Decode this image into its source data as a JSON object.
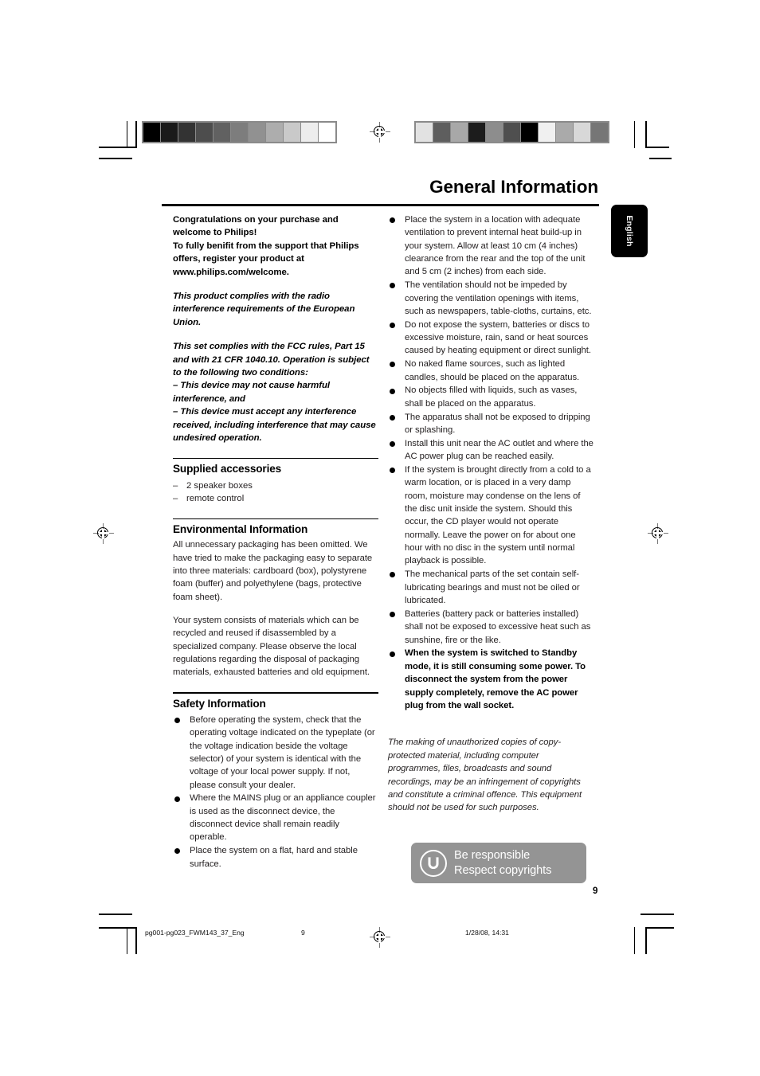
{
  "page": {
    "title": "General Information",
    "language_tab": "English",
    "page_number": "9"
  },
  "left_column": {
    "welcome_block": "Congratulations on your purchase and welcome to Philips!\nTo fully benifit from the support that Philips offers, register your product at www.philips.com/welcome.",
    "eu_notice": "This product complies with the radio interference requirements of the European Union.",
    "fcc_notice": "This set complies with the FCC rules, Part 15 and with 21 CFR 1040.10. Operation is subject to the following two conditions:\n–  This device may not cause harmful interference, and\n–  This device must accept any interference received, including interference that may cause undesired operation.",
    "supplied_accessories": {
      "heading": "Supplied accessories",
      "items": [
        "2 speaker boxes",
        "remote control"
      ],
      "dash": "–"
    },
    "environmental_information": {
      "heading": "Environmental Information",
      "paragraphs": [
        "All unnecessary packaging has been omitted. We have tried to make the packaging easy to separate into three materials: cardboard (box), polystyrene foam (buffer) and polyethylene (bags, protective foam sheet).",
        "Your system consists of materials which can be recycled and reused if disassembled by a specialized company. Please observe the local regulations regarding the disposal of packaging materials, exhausted batteries and old equipment."
      ]
    },
    "safety_information": {
      "heading": "Safety Information",
      "bullets": [
        "Before operating the system, check that the operating voltage indicated on the typeplate (or the voltage indication beside the voltage selector) of your system is identical with the voltage of your local power supply. If not, please consult your dealer.",
        "Where the MAINS plug or an appliance coupler is used as the disconnect device, the disconnect device shall remain readily operable.",
        "Place the system on a flat, hard and stable surface."
      ]
    }
  },
  "right_column": {
    "bullets": [
      "Place the system in a location with adequate ventilation to prevent internal heat build-up in your system. Allow at least 10 cm (4 inches) clearance from the rear and the top of the unit and 5 cm (2 inches) from each side.",
      "The ventilation should not be impeded by covering the ventilation openings with items, such as newspapers, table-cloths, curtains, etc.",
      "Do not expose the system, batteries or discs to excessive moisture, rain, sand or heat sources caused by heating equipment or direct sunlight.",
      "No naked flame sources, such as lighted candles, should be placed on the apparatus.",
      "No objects filled with liquids, such as vases, shall be placed on the apparatus.",
      "The apparatus shall not be exposed to dripping or splashing.",
      "Install this unit near the AC outlet and where the AC power plug can be reached easily.",
      "If the system is brought directly from a cold to a warm location, or is placed in a very damp room, moisture may condense on the lens of the disc unit inside the system. Should this occur, the CD player would not operate normally. Leave the power on for about one hour with no disc in the system until normal playback is possible.",
      "The mechanical parts of the set contain self-lubricating bearings and must not be oiled or lubricated.",
      "Batteries (battery pack or batteries installed) shall not be exposed to excessive heat such as sunshine, fire or the like."
    ],
    "bold_bullet": "When the system is switched to Standby mode, it is still consuming some power. To disconnect the system from the power supply completely, remove the AC power plug from the wall socket.",
    "copyright_note": "The making of unauthorized copies of copy-protected material, including computer programmes, files, broadcasts and sound recordings, may be an infringement of copyrights and constitute a criminal offence. This equipment should not be used for such purposes.",
    "badge": {
      "line1": "Be responsible",
      "line2": "Respect copyrights"
    }
  },
  "footer": {
    "file_name": "pg001-pg023_FWM143_37_Eng",
    "page_number": "9",
    "timestamp": "1/28/08, 14:31"
  },
  "calibration_strips": {
    "left_swatches": [
      "#000000",
      "#1a1a1a",
      "#333333",
      "#4d4d4d",
      "#616161",
      "#7d7d7d",
      "#919191",
      "#adadad",
      "#c9c9c9",
      "#ededed",
      "#ffffff"
    ],
    "right_swatches": [
      "#e2e2e2",
      "#5e5e5e",
      "#a8a8a8",
      "#1c1c1c",
      "#8d8d8d",
      "#4f4f4f",
      "#000000",
      "#f0f0f0",
      "#aaaaaa",
      "#d8d8d8",
      "#767676"
    ]
  },
  "colors": {
    "badge_background": "#949494",
    "tab_background": "#000000",
    "text": "#231f20"
  }
}
